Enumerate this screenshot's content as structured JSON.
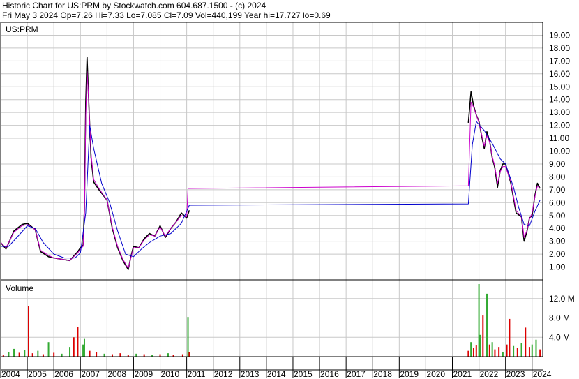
{
  "header": {
    "title": "Historic Chart for US:PRM by Stockwatch.com 604.687.1500 - (c) 2024",
    "info": "Fri May  3 2024   Op=7.26   Hi=7.33   Lo=7.085   Cl=7.09   Vol=440,199   Year hi=17.727   lo=0.69"
  },
  "chart_data": {
    "type": "line",
    "symbol_label": "US:PRM",
    "volume_label": "Volume",
    "x_axis": {
      "range": [
        2004.0,
        2024.4
      ],
      "ticks": [
        "2004",
        "2005",
        "2006",
        "2007",
        "2008",
        "2009",
        "2010",
        "2011",
        "2012",
        "2013",
        "2014",
        "2015",
        "2016",
        "2017",
        "2018",
        "2019",
        "2020",
        "2021",
        "2022",
        "2023",
        "2024"
      ]
    },
    "price_axis": {
      "range": [
        0,
        20
      ],
      "ticks": [
        "1.00",
        "2.00",
        "3.00",
        "4.00",
        "5.00",
        "6.00",
        "7.00",
        "8.00",
        "9.00",
        "10.00",
        "11.00",
        "12.00",
        "13.00",
        "14.00",
        "15.00",
        "16.00",
        "17.00",
        "18.00",
        "19.00"
      ]
    },
    "volume_axis": {
      "range": [
        0,
        15
      ],
      "ticks": [
        "4.0 M",
        "8.0 M",
        "12.0 M"
      ]
    },
    "colors": {
      "price": "#000000",
      "ma_short": "#cc00cc",
      "ma_long": "#0000cc",
      "volume_up": "#33aa33",
      "volume_down": "#dd0000",
      "grid": "#c8c8c8"
    },
    "series": [
      {
        "key": "price",
        "x": [
          2004.0,
          2004.2,
          2004.5,
          2004.8,
          2005.0,
          2005.3,
          2005.5,
          2005.8,
          2006.0,
          2006.3,
          2006.6,
          2006.9,
          2007.0,
          2007.1,
          2007.15,
          2007.2,
          2007.25,
          2007.3,
          2007.4,
          2007.5,
          2007.7,
          2008.0,
          2008.2,
          2008.4,
          2008.6,
          2008.8,
          2008.9,
          2009.0,
          2009.2,
          2009.4,
          2009.6,
          2009.8,
          2010.0,
          2010.2,
          2010.4,
          2010.6,
          2010.8,
          2011.0,
          2011.1
        ],
        "y": [
          2.9,
          2.4,
          3.8,
          4.3,
          4.4,
          3.9,
          2.2,
          1.8,
          1.7,
          1.6,
          1.5,
          2.2,
          2.5,
          2.7,
          5.5,
          13.8,
          17.3,
          14.5,
          9.5,
          7.6,
          7.0,
          6.2,
          4.0,
          2.5,
          1.5,
          0.8,
          1.8,
          2.6,
          2.5,
          3.2,
          3.6,
          3.4,
          4.2,
          3.3,
          4.0,
          4.5,
          5.2,
          4.8,
          5.4
        ]
      },
      {
        "key": "price",
        "x": [
          2021.6,
          2021.7,
          2021.8,
          2021.9,
          2022.0,
          2022.1,
          2022.2,
          2022.3,
          2022.4,
          2022.5,
          2022.6,
          2022.7,
          2022.8,
          2022.9,
          2023.0,
          2023.2,
          2023.4,
          2023.6,
          2023.7,
          2023.8,
          2023.9,
          2024.0,
          2024.1,
          2024.2,
          2024.3
        ],
        "y": [
          12.2,
          14.6,
          13.5,
          12.8,
          12.3,
          11.2,
          10.2,
          11.5,
          10.8,
          9.5,
          8.7,
          7.2,
          8.5,
          9.0,
          9.0,
          7.5,
          5.2,
          4.9,
          3.0,
          3.7,
          4.8,
          5.0,
          6.5,
          7.5,
          7.1
        ]
      },
      {
        "key": "ma_short",
        "x": [
          2004.0,
          2004.2,
          2004.5,
          2004.8,
          2005.0,
          2005.3,
          2005.5,
          2005.8,
          2006.0,
          2006.3,
          2006.6,
          2006.9,
          2007.0,
          2007.1,
          2007.15,
          2007.2,
          2007.25,
          2007.3,
          2007.4,
          2007.5,
          2007.7,
          2008.0,
          2008.2,
          2008.4,
          2008.6,
          2008.8,
          2008.9,
          2009.0,
          2009.2,
          2009.4,
          2009.6,
          2009.8,
          2010.0,
          2010.2,
          2010.4,
          2010.6,
          2010.8,
          2011.0,
          2011.05,
          2021.6,
          2021.7,
          2021.8,
          2021.9,
          2022.0,
          2022.1,
          2022.2,
          2022.3,
          2022.4,
          2022.5,
          2022.6,
          2022.7,
          2022.8,
          2022.9,
          2023.0,
          2023.2,
          2023.4,
          2023.6,
          2023.7,
          2023.8,
          2023.9,
          2024.0,
          2024.1,
          2024.2,
          2024.3
        ],
        "y": [
          2.9,
          2.5,
          3.7,
          4.2,
          4.3,
          3.9,
          2.3,
          1.9,
          1.7,
          1.6,
          1.5,
          2.1,
          2.4,
          2.6,
          4.8,
          12.6,
          16.2,
          14.4,
          9.8,
          7.8,
          7.1,
          6.2,
          4.1,
          2.6,
          1.6,
          0.9,
          1.7,
          2.5,
          2.5,
          3.1,
          3.5,
          3.4,
          4.1,
          3.4,
          4.0,
          4.5,
          5.0,
          4.9,
          7.1,
          7.3,
          13.8,
          13.4,
          12.8,
          12.2,
          11.3,
          10.4,
          11.2,
          10.7,
          9.6,
          8.8,
          7.5,
          8.4,
          8.8,
          8.8,
          7.6,
          5.4,
          4.9,
          3.3,
          3.8,
          4.7,
          5.2,
          6.4,
          7.3,
          7.1
        ]
      },
      {
        "key": "ma_long",
        "x": [
          2004.0,
          2004.3,
          2004.7,
          2005.0,
          2005.3,
          2005.6,
          2006.0,
          2006.4,
          2006.8,
          2007.0,
          2007.2,
          2007.35,
          2007.5,
          2007.8,
          2008.1,
          2008.4,
          2008.7,
          2009.0,
          2009.3,
          2009.6,
          2010.0,
          2010.4,
          2010.8,
          2011.1,
          2021.6,
          2021.75,
          2021.9,
          2022.2,
          2022.5,
          2022.8,
          2023.0,
          2023.3,
          2023.5,
          2023.7,
          2023.9,
          2024.1,
          2024.3
        ],
        "y": [
          2.6,
          2.6,
          3.5,
          4.2,
          4.0,
          2.9,
          2.0,
          1.7,
          1.7,
          2.1,
          5.2,
          12.0,
          10.2,
          7.5,
          6.0,
          3.8,
          2.0,
          1.8,
          2.4,
          2.9,
          3.4,
          3.6,
          4.4,
          5.8,
          5.9,
          10.5,
          12.3,
          11.6,
          10.6,
          9.4,
          9.0,
          7.2,
          5.6,
          4.3,
          4.2,
          5.3,
          6.2
        ]
      }
    ],
    "volume": [
      {
        "x": 2004.1,
        "v": 0.4,
        "dir": "down"
      },
      {
        "x": 2004.3,
        "v": 0.9,
        "dir": "up"
      },
      {
        "x": 2004.5,
        "v": 1.6,
        "dir": "up"
      },
      {
        "x": 2004.7,
        "v": 0.8,
        "dir": "down"
      },
      {
        "x": 2004.9,
        "v": 1.3,
        "dir": "up"
      },
      {
        "x": 2005.05,
        "v": 10.5,
        "dir": "down"
      },
      {
        "x": 2005.2,
        "v": 0.7,
        "dir": "down"
      },
      {
        "x": 2005.4,
        "v": 1.2,
        "dir": "up"
      },
      {
        "x": 2005.6,
        "v": 0.5,
        "dir": "down"
      },
      {
        "x": 2005.8,
        "v": 3.0,
        "dir": "up"
      },
      {
        "x": 2006.0,
        "v": 0.8,
        "dir": "down"
      },
      {
        "x": 2006.3,
        "v": 0.6,
        "dir": "up"
      },
      {
        "x": 2006.6,
        "v": 2.0,
        "dir": "up"
      },
      {
        "x": 2006.75,
        "v": 4.0,
        "dir": "down"
      },
      {
        "x": 2006.9,
        "v": 6.2,
        "dir": "down"
      },
      {
        "x": 2007.1,
        "v": 2.5,
        "dir": "up"
      },
      {
        "x": 2007.15,
        "v": 3.8,
        "dir": "up"
      },
      {
        "x": 2007.35,
        "v": 1.2,
        "dir": "down"
      },
      {
        "x": 2007.6,
        "v": 0.9,
        "dir": "down"
      },
      {
        "x": 2007.9,
        "v": 0.6,
        "dir": "up"
      },
      {
        "x": 2008.2,
        "v": 0.5,
        "dir": "down"
      },
      {
        "x": 2008.5,
        "v": 0.7,
        "dir": "down"
      },
      {
        "x": 2008.8,
        "v": 0.4,
        "dir": "down"
      },
      {
        "x": 2009.1,
        "v": 0.6,
        "dir": "up"
      },
      {
        "x": 2009.4,
        "v": 0.5,
        "dir": "down"
      },
      {
        "x": 2009.7,
        "v": 0.4,
        "dir": "up"
      },
      {
        "x": 2010.0,
        "v": 0.5,
        "dir": "down"
      },
      {
        "x": 2010.3,
        "v": 0.7,
        "dir": "up"
      },
      {
        "x": 2010.5,
        "v": 0.3,
        "dir": "down"
      },
      {
        "x": 2010.85,
        "v": 0.5,
        "dir": "down"
      },
      {
        "x": 2011.05,
        "v": 8.2,
        "dir": "up"
      },
      {
        "x": 2011.1,
        "v": 1.0,
        "dir": "down"
      },
      {
        "x": 2021.6,
        "v": 1.2,
        "dir": "down"
      },
      {
        "x": 2021.7,
        "v": 3.0,
        "dir": "up"
      },
      {
        "x": 2021.8,
        "v": 1.8,
        "dir": "down"
      },
      {
        "x": 2021.9,
        "v": 2.3,
        "dir": "down"
      },
      {
        "x": 2022.0,
        "v": 15.0,
        "dir": "up"
      },
      {
        "x": 2022.05,
        "v": 4.5,
        "dir": "up"
      },
      {
        "x": 2022.15,
        "v": 8.5,
        "dir": "down"
      },
      {
        "x": 2022.3,
        "v": 13.0,
        "dir": "up"
      },
      {
        "x": 2022.4,
        "v": 2.5,
        "dir": "down"
      },
      {
        "x": 2022.5,
        "v": 3.0,
        "dir": "up"
      },
      {
        "x": 2022.6,
        "v": 1.5,
        "dir": "down"
      },
      {
        "x": 2022.75,
        "v": 2.0,
        "dir": "down"
      },
      {
        "x": 2022.9,
        "v": 1.0,
        "dir": "up"
      },
      {
        "x": 2023.05,
        "v": 2.5,
        "dir": "down"
      },
      {
        "x": 2023.15,
        "v": 7.8,
        "dir": "down"
      },
      {
        "x": 2023.3,
        "v": 2.2,
        "dir": "up"
      },
      {
        "x": 2023.45,
        "v": 1.8,
        "dir": "down"
      },
      {
        "x": 2023.6,
        "v": 2.8,
        "dir": "up"
      },
      {
        "x": 2023.75,
        "v": 6.0,
        "dir": "down"
      },
      {
        "x": 2023.9,
        "v": 2.0,
        "dir": "down"
      },
      {
        "x": 2024.0,
        "v": 2.5,
        "dir": "up"
      },
      {
        "x": 2024.15,
        "v": 3.5,
        "dir": "up"
      },
      {
        "x": 2024.3,
        "v": 1.5,
        "dir": "down"
      }
    ]
  }
}
